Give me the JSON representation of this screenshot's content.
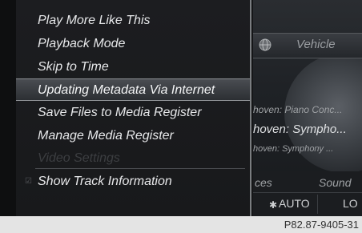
{
  "menu": {
    "items": [
      {
        "label": "Play More Like This",
        "state": "normal"
      },
      {
        "label": "Playback Mode",
        "state": "normal"
      },
      {
        "label": "Skip to Time",
        "state": "normal"
      },
      {
        "label": "Updating Metadata Via Internet",
        "state": "selected"
      },
      {
        "label": "Save Files to Media Register",
        "state": "normal"
      },
      {
        "label": "Manage Media Register",
        "state": "normal"
      },
      {
        "label": "Video Settings",
        "state": "disabled"
      },
      {
        "label": "Show Track Information",
        "state": "checked"
      }
    ]
  },
  "background": {
    "vehicle_label": "Vehicle",
    "track_1": "hoven: Piano Conc...",
    "track_2": "hoven: Sympho...",
    "track_3": "hoven: Symphony ...",
    "sources_label": "ces",
    "sound_label": "Sound",
    "fan_label": "AUTO",
    "lo_label": "LO"
  },
  "footer": {
    "figure_ref": "P82.87-9405-31"
  },
  "icons": {
    "globe": "globe-icon",
    "fan": "fan-icon",
    "check": "check-icon"
  }
}
